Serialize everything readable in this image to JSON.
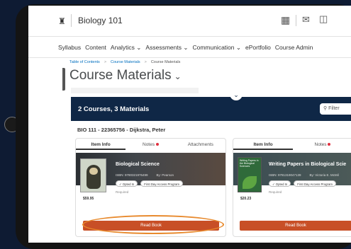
{
  "topbar": {
    "course_title": "Biology 101"
  },
  "menu": [
    "Syllabus",
    "Content",
    "Analytics ⌄",
    "Assessments ⌄",
    "Communication ⌄",
    "ePortfolio",
    "Course Admin"
  ],
  "breadcrumb": {
    "item1": "Table of Contents",
    "item2": "Course Materials",
    "item3": "Course Materials"
  },
  "page": {
    "title": "Course Materials",
    "summary": "2 Courses, 3 Materials",
    "filter_label": "Filter",
    "course_line": "BIO 111 - 22365756 - Dijkstra, Peter"
  },
  "cards": [
    {
      "tabs": [
        "Item Info",
        "Notes",
        "Attachments"
      ],
      "title": "Biological Science",
      "isbn": "ISBN: 9780321976499",
      "by": "By: Pearson",
      "chip1": "Opted In",
      "chip2": "First Day Access Program",
      "required": "Required",
      "price": "$59.95",
      "button": "Read Book"
    },
    {
      "tabs": [
        "Item Info",
        "Notes"
      ],
      "title": "Writing Papers in Biological Scie",
      "cover_text": "Writing Papers in the Biological Sciences",
      "isbn": "ISBN: 9781319047139",
      "by": "By: Victoria E. McMil",
      "chip1": "Opted In",
      "chip2": "First Day Access Program",
      "required": "Required",
      "price": "$20.23",
      "button": "Read Book"
    }
  ],
  "colors": {
    "band": "#0f2746",
    "button": "#c84f26",
    "highlight": "#e88a2e",
    "notes_dot": "#e0303f"
  },
  "icons": [
    "home-icon",
    "grid-icon",
    "mail-icon",
    "chat-icon",
    "chevron-down-icon",
    "search-icon"
  ]
}
